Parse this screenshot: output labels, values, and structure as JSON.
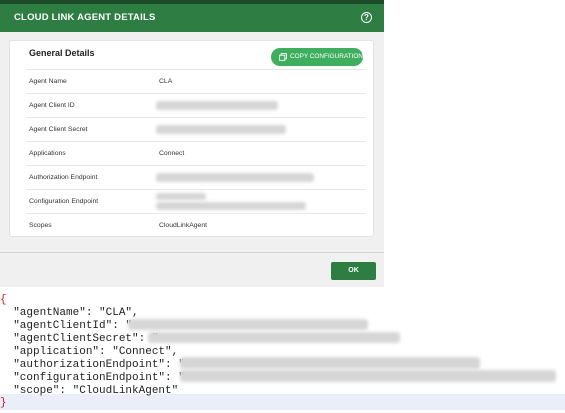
{
  "dialog": {
    "title": "CLOUD LINK AGENT DETAILS",
    "help_icon": "?",
    "card_title": "General Details",
    "copy_button": "COPY CONFIGURATION",
    "ok_button": "OK",
    "colors": {
      "header": "#2e7d43",
      "button": "#3fae5e"
    },
    "rows": [
      {
        "label": "Agent Name",
        "value": "CLA"
      },
      {
        "label": "Agent Client ID",
        "value": ""
      },
      {
        "label": "Agent Client Secret",
        "value": ""
      },
      {
        "label": "Applications",
        "value": "Connect"
      },
      {
        "label": "Authorization Endpoint",
        "value": ""
      },
      {
        "label": "Configuration Endpoint",
        "value": ""
      },
      {
        "label": "Scopes",
        "value": "CloudLinkAgent"
      }
    ]
  },
  "json_view": {
    "open_brace": "{",
    "close_brace": "}",
    "lines": [
      "  \"agentName\": \"CLA\",",
      "  \"agentClientId\": \"",
      "  \"agentClientSecret\": \"",
      "  \"application\": \"Connect\",",
      "  \"authorizationEndpoint\": \"",
      "  \"configurationEndpoint\": \"",
      "  \"scope\": \"CloudLinkAgent\""
    ]
  }
}
